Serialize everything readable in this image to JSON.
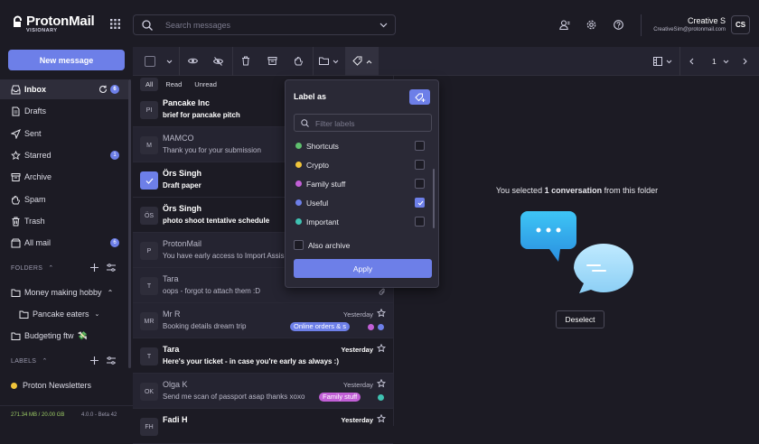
{
  "header": {
    "logo_text": "ProtonMail",
    "logo_sub": "VISIONARY",
    "search_placeholder": "Search messages",
    "user_name": "Creative S",
    "user_email": "CreativeSim@protonmail.com",
    "avatar_initials": "CS"
  },
  "sidebar": {
    "new_message": "New message",
    "items": [
      {
        "label": "Inbox",
        "icon": "inbox-icon",
        "count": "6"
      },
      {
        "label": "Drafts",
        "icon": "drafts-icon"
      },
      {
        "label": "Sent",
        "icon": "sent-icon"
      },
      {
        "label": "Starred",
        "icon": "star-icon",
        "count": "1"
      },
      {
        "label": "Archive",
        "icon": "archive-icon"
      },
      {
        "label": "Spam",
        "icon": "spam-icon"
      },
      {
        "label": "Trash",
        "icon": "trash-icon"
      },
      {
        "label": "All mail",
        "icon": "all-mail-icon",
        "count": "6"
      }
    ],
    "folders_title": "FOLDERS",
    "folders": [
      {
        "label": "Money making hobby"
      },
      {
        "label": "Pancake eaters"
      },
      {
        "label": "Budgeting ftw"
      }
    ],
    "labels_title": "LABELS",
    "labels": [
      {
        "label": "Proton Newsletters",
        "color": "#f0c43a"
      }
    ],
    "storage": "271.34 MB / 20.00 GB",
    "version": "4.0.0 - Beta 42"
  },
  "toolbar": {
    "page": "1"
  },
  "filters": [
    "All",
    "Read",
    "Unread"
  ],
  "messages": [
    {
      "initials": "PI",
      "sender": "Pancake Inc",
      "subject": "brief for pancake pitch",
      "unread": true
    },
    {
      "initials": "M",
      "sender": "MAMCO",
      "subject": "Thank you for your submission",
      "unread": false
    },
    {
      "initials": "",
      "sender": "Örs Singh",
      "subject": "Draft paper",
      "unread": true,
      "selected": true
    },
    {
      "initials": "ÖS",
      "sender": "Örs Singh",
      "subject": "photo shoot tentative schedule",
      "unread": true
    },
    {
      "initials": "P",
      "sender": "ProtonMail",
      "subject": "You have early access to Import Assis",
      "unread": false
    },
    {
      "initials": "T",
      "sender": "Tara",
      "subject": "oops - forgot to attach them :D",
      "unread": false
    },
    {
      "initials": "MR",
      "sender": "Mr R",
      "subject": "Booking details dream trip",
      "date": "Yesterday",
      "chip": "Online orders & s",
      "unread": false
    },
    {
      "initials": "T",
      "sender": "Tara",
      "subject": "Here's your ticket - in case you're early as always :)",
      "date": "Yesterday",
      "unread": true
    },
    {
      "initials": "OK",
      "sender": "Olga K",
      "subject": "Send me scan of passport asap thanks xoxo",
      "date": "Yesterday",
      "chip": "Family stuff",
      "unread": false
    },
    {
      "initials": "FH",
      "sender": "Fadi H",
      "subject": "",
      "date": "Yesterday",
      "unread": true
    }
  ],
  "right": {
    "selected_prefix": "You selected ",
    "selected_count": "1 conversation",
    "selected_suffix": " from this folder",
    "deselect": "Deselect"
  },
  "label_dropdown": {
    "title": "Label as",
    "filter_placeholder": "Filter labels",
    "labels": [
      {
        "name": "Shortcuts",
        "color": "#5fbf6e",
        "checked": false
      },
      {
        "name": "Crypto",
        "color": "#f0c43a",
        "checked": false
      },
      {
        "name": "Family stuff",
        "color": "#c15fd6",
        "checked": false
      },
      {
        "name": "Useful",
        "color": "#6d7fe8",
        "checked": true
      },
      {
        "name": "Important",
        "color": "#3fc2b2",
        "checked": false
      }
    ],
    "also_archive": "Also archive",
    "apply": "Apply"
  },
  "colors": {
    "accent": "#6d7fe8",
    "background": "#1c1b24",
    "chip_online_orders": "#6d7fe8",
    "chip_family": "#c15fd6"
  }
}
